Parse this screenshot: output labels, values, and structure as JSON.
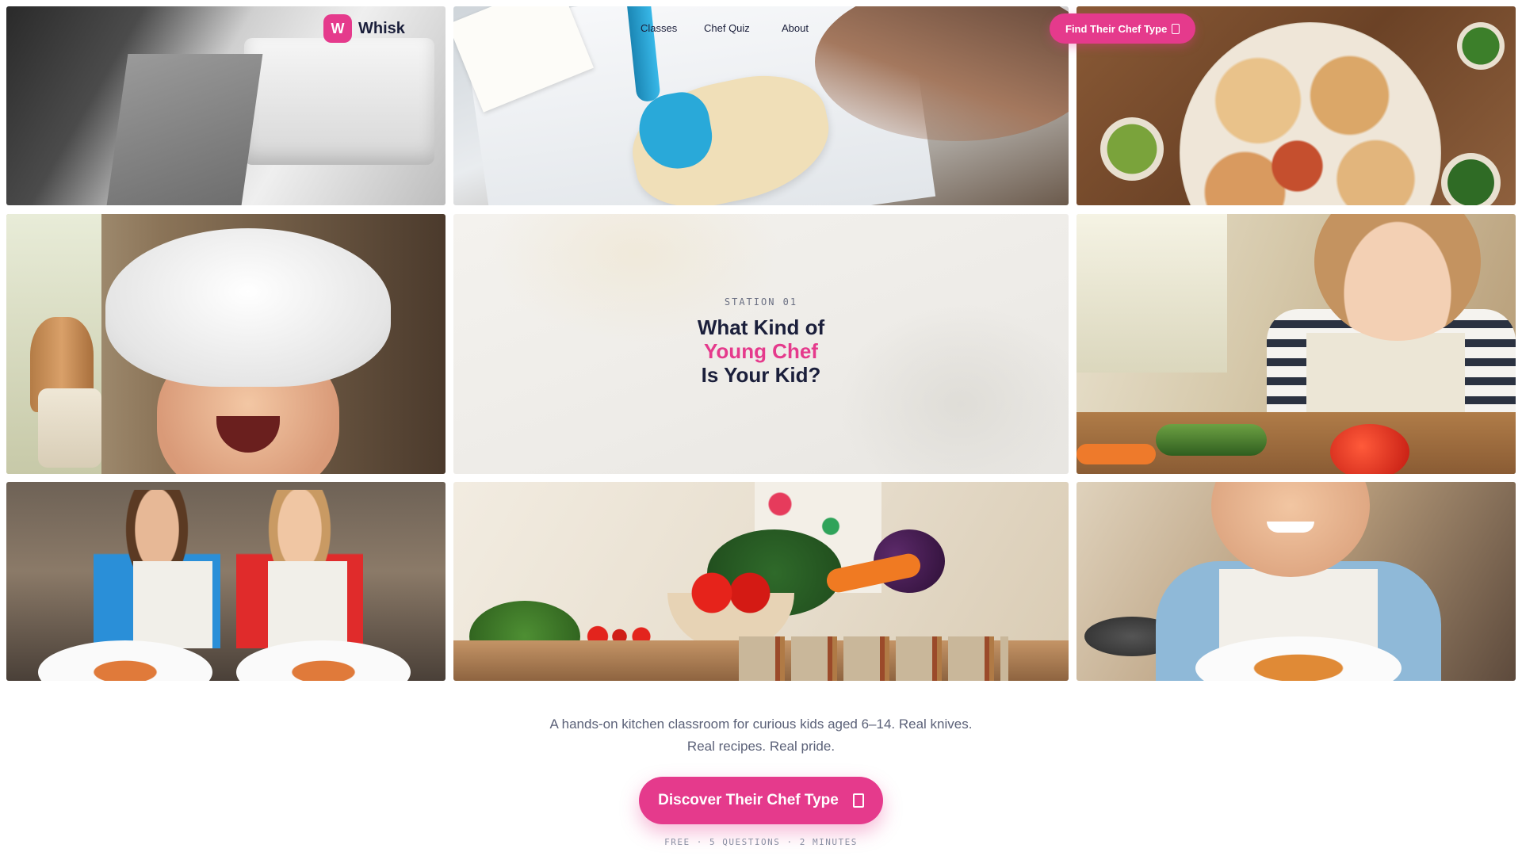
{
  "nav": {
    "logo_letter": "W",
    "brand": "Whisk",
    "links": [
      "Classes",
      "Chef Quiz",
      "About"
    ],
    "cta_label": "Find Their Chef Type",
    "cta_icon": "arrow-icon"
  },
  "hero": {
    "eyebrow": "STATION 01",
    "title_line1": "What Kind of",
    "title_highlight": "Young Chef",
    "title_line3": "Is Your Kid?",
    "tagline": "A hands-on kitchen classroom for curious kids aged 6–14. Real knives. Real recipes. Real pride.",
    "cta_label": "Discover Their Chef Type",
    "cta_icon": "arrow-icon",
    "meta": "FREE · 5 QUESTIONS · 2 MINUTES"
  },
  "colors": {
    "accent": "#e53a8c",
    "navy": "#1b1f3b",
    "muted": "#5b6178"
  }
}
